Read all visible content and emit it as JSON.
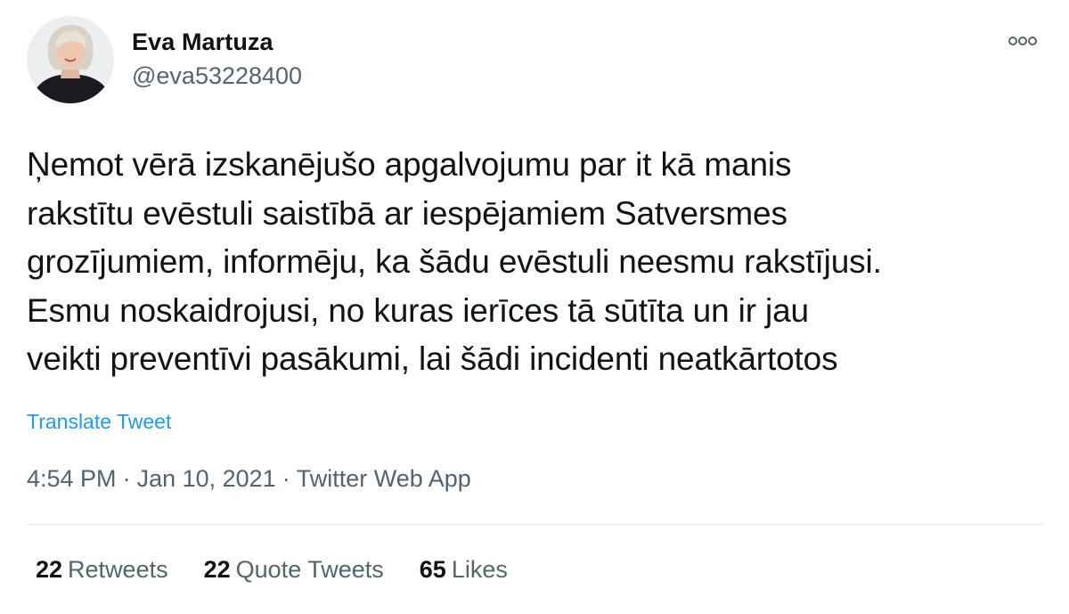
{
  "author": {
    "display_name": "Eva Martuza",
    "handle": "@eva53228400",
    "avatar_icon": "profile-photo"
  },
  "more_icon": "ellipsis-icon",
  "tweet": {
    "lines": [
      "Ņemot vērā izskanējušo apgalvojumu par it kā manis",
      "rakstītu evēstuli saistībā ar iespējamiem Satversmes",
      "grozījumiem, informēju, ka šādu evēstuli neesmu rakstījusi.",
      "Esmu noskaidrojusi, no kuras ierīces tā sūtīta un ir jau",
      "veikti preventīvi pasākumi, lai šādi incidenti neatkārtotos"
    ]
  },
  "translate_label": "Translate Tweet",
  "meta": {
    "time": "4:54 PM",
    "separator": "·",
    "date": "Jan 10, 2021",
    "source": "Twitter Web App"
  },
  "stats": {
    "retweets": {
      "count": "22",
      "label": "Retweets"
    },
    "quote_tweets": {
      "count": "22",
      "label": "Quote Tweets"
    },
    "likes": {
      "count": "65",
      "label": "Likes"
    }
  },
  "colors": {
    "link": "#1d9bf0",
    "secondary_text": "#536471",
    "primary_text": "#0f1419",
    "divider": "#e6ecf0"
  }
}
